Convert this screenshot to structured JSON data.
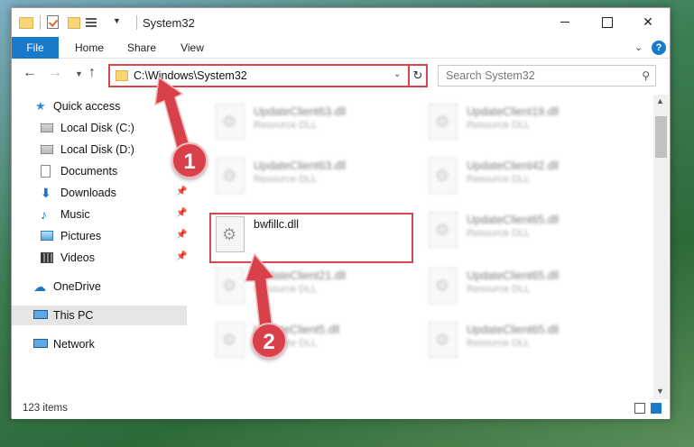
{
  "window": {
    "title": "System32"
  },
  "ribbon": {
    "tabs": [
      {
        "label": "File"
      },
      {
        "label": "Home"
      },
      {
        "label": "Share"
      },
      {
        "label": "View"
      }
    ],
    "help_label": "?"
  },
  "navigation": {
    "address": "C:\\Windows\\System32",
    "search_placeholder": "Search System32"
  },
  "sidebar": {
    "items": [
      {
        "label": "Quick access",
        "icon": "star-icon"
      },
      {
        "label": "Local Disk (C:)",
        "icon": "drive-icon"
      },
      {
        "label": "Local Disk (D:)",
        "icon": "drive-icon"
      },
      {
        "label": "Documents",
        "icon": "document-icon"
      },
      {
        "label": "Downloads",
        "icon": "download-icon"
      },
      {
        "label": "Music",
        "icon": "music-icon"
      },
      {
        "label": "Pictures",
        "icon": "pictures-icon"
      },
      {
        "label": "Videos",
        "icon": "video-icon"
      },
      {
        "label": "OneDrive",
        "icon": "cloud-icon"
      },
      {
        "label": "This PC",
        "icon": "computer-icon",
        "selected": true
      },
      {
        "label": "Network",
        "icon": "network-icon"
      }
    ]
  },
  "files": [
    {
      "name": "UpdateClient63.dll",
      "desc": "Resource DLL"
    },
    {
      "name": "UpdateClient19.dll",
      "desc": "Resource DLL"
    },
    {
      "name": "UpdateClient63.dll",
      "desc": "Resource DLL"
    },
    {
      "name": "UpdateClient42.dll",
      "desc": "Resource DLL"
    },
    {
      "name": "bwfillc.dll",
      "desc": ""
    },
    {
      "name": "UpdateClient65.dll",
      "desc": "Resource DLL"
    },
    {
      "name": "UpdateClient21.dll",
      "desc": "Resource DLL"
    },
    {
      "name": "UpdateClient65.dll",
      "desc": "Resource DLL"
    },
    {
      "name": "UpdateClient5.dll",
      "desc": "Resource DLL"
    },
    {
      "name": "UpdateClient65.dll",
      "desc": "Resource DLL"
    }
  ],
  "status": {
    "item_count": "123 items"
  },
  "annotations": {
    "step1": "1",
    "step2": "2",
    "color": "#d9414a"
  }
}
